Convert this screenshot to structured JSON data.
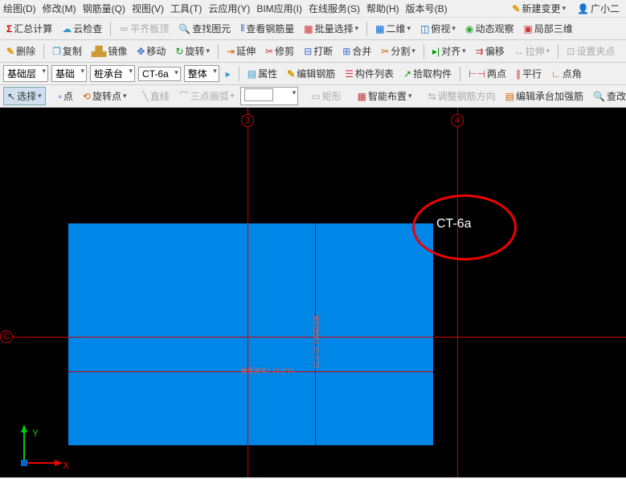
{
  "menubar": {
    "items": [
      "绘图(D)",
      "修改(M)",
      "钢筋量(Q)",
      "视图(V)",
      "工具(T)",
      "云应用(Y)",
      "BIM应用(I)",
      "在线服务(S)",
      "帮助(H)",
      "版本号(B)"
    ],
    "new_change": "新建变更",
    "user": "广小二"
  },
  "tb1": {
    "sum": "汇总计算",
    "cloud": "云检查",
    "flatboard": "平齐板顶",
    "find": "查找图元",
    "viewbar": "查看钢筋量",
    "batch": "批量选择",
    "view2d": "二维",
    "persp": "俯视",
    "dynview": "动态观察",
    "local3d": "局部三维"
  },
  "tb2": {
    "delete": "删除",
    "copy": "复制",
    "mirror": "镜像",
    "move": "移动",
    "rotate": "旋转",
    "extend": "延伸",
    "trim": "修剪",
    "break": "打断",
    "join": "合并",
    "split": "分割",
    "align": "对齐",
    "offset": "偏移",
    "stretch": "拉伸",
    "grips": "设置夹点"
  },
  "tb3": {
    "floor": "基础层",
    "cat": "基础",
    "subcat": "桩承台",
    "comp": "CT-6a",
    "scope": "整体",
    "props": "属性",
    "editbar": "编辑钢筋",
    "complist": "构件列表",
    "pick": "拾取构件",
    "twopoint": "两点",
    "parallel": "平行",
    "pointangle": "点角"
  },
  "tb4": {
    "select": "选择",
    "point": "点",
    "rotpoint": "旋转点",
    "line": "直线",
    "arc3": "三点画弧",
    "rect": "矩形",
    "smart": "智能布置",
    "adjdir": "调整钢筋方向",
    "editplat": "编辑承台加强筋",
    "chg": "查改村"
  },
  "canvas": {
    "grid_labels": {
      "v1": "3",
      "v2": "4",
      "h": "C"
    },
    "label": "CT-6a",
    "ucs": {
      "x": "X",
      "y": "Y"
    },
    "dim_text": "模型建筑2 15.0*15"
  }
}
